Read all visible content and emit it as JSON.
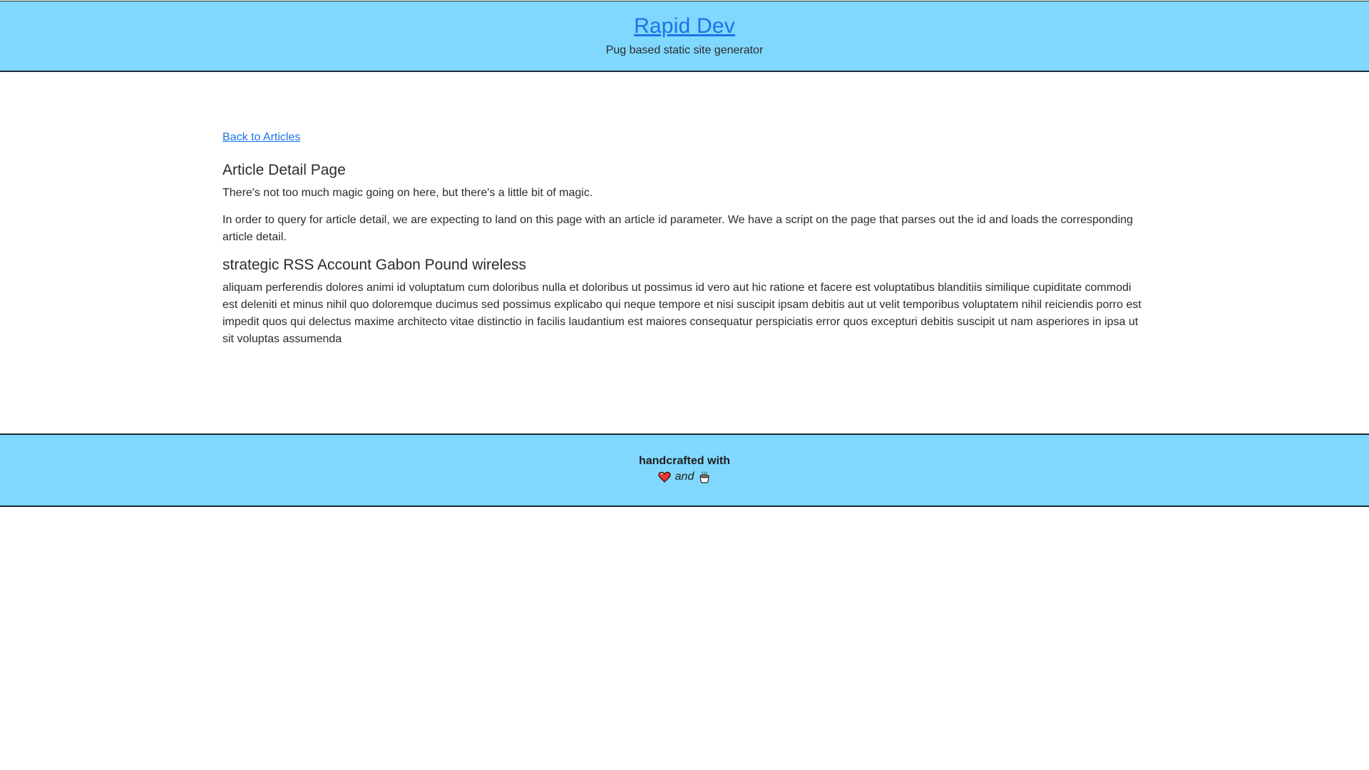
{
  "header": {
    "title": "Rapid Dev",
    "tagline": "Pug based static site generator"
  },
  "main": {
    "back_link": "Back to Articles",
    "page_heading": "Article Detail Page",
    "intro_paragraphs": [
      "There's not too much magic going on here, but there's a little bit of magic.",
      "In order to query for article detail, we are expecting to land on this page with an article id parameter. We have a script on the page that parses out the id and loads the corresponding article detail."
    ],
    "article": {
      "title": "strategic RSS Account Gabon Pound wireless",
      "body": "aliquam perferendis dolores animi id voluptatum cum doloribus nulla et doloribus ut possimus id vero aut hic ratione et facere est voluptatibus blanditiis similique cupiditate commodi est deleniti et minus nihil quo doloremque ducimus sed possimus explicabo qui neque tempore et nisi suscipit ipsam debitis aut ut velit temporibus voluptatem nihil reiciendis porro est impedit quos qui delectus maxime architecto vitae distinctio in facilis laudantium est maiores consequatur perspiciatis error quos excepturi debitis suscipit ut nam asperiores in ipsa ut sit voluptas assumenda"
    }
  },
  "footer": {
    "line1": "handcrafted with",
    "and_text": "and",
    "icons": [
      "heart-icon",
      "coffee-icon"
    ]
  },
  "colors": {
    "band": "#80d8ff",
    "link": "#1a73e8",
    "border": "#1c2a33"
  }
}
